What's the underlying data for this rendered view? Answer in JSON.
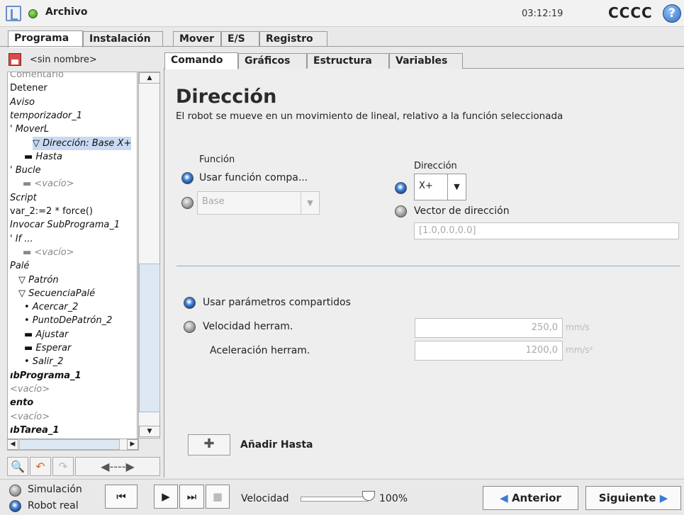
{
  "header": {
    "file_menu": "Archivo",
    "clock": "03:12:19",
    "robot_name": "CCCC",
    "help": "?"
  },
  "main_tabs": [
    "Programa",
    "Instalación",
    "Mover",
    "E/S",
    "Registro"
  ],
  "left": {
    "program_name": "<sin nombre>",
    "tree": [
      {
        "text": "Comentario",
        "cls": "g"
      },
      {
        "text": "Detener",
        "cls": ""
      },
      {
        "text": "Aviso",
        "cls": "i"
      },
      {
        "text": "temporizador_1",
        "cls": "i"
      },
      {
        "text": "' MoverL",
        "cls": "i"
      },
      {
        "text": "▽ Dirección: Base X+",
        "cls": "i sel"
      },
      {
        "text": "▬ Hasta",
        "cls": "i"
      },
      {
        "text": "' Bucle",
        "cls": "i"
      },
      {
        "text": "▬ <vacío>",
        "cls": "i g"
      },
      {
        "text": "Script",
        "cls": "i"
      },
      {
        "text": "var_2:=2 * force()",
        "cls": ""
      },
      {
        "text": "Invocar SubPrograma_1",
        "cls": "i"
      },
      {
        "text": "' If ...",
        "cls": "i"
      },
      {
        "text": "▬ <vacío>",
        "cls": "i g"
      },
      {
        "text": "Palé",
        "cls": "i"
      },
      {
        "text": "▽ Patrón",
        "cls": "i"
      },
      {
        "text": "▽ SecuenciaPalé",
        "cls": "i"
      },
      {
        "text": "• Acercar_2",
        "cls": "i"
      },
      {
        "text": "• PuntoDePatrón_2",
        "cls": "i"
      },
      {
        "text": "▬ Ajustar",
        "cls": "i"
      },
      {
        "text": "▬ Esperar",
        "cls": "i"
      },
      {
        "text": "• Salir_2",
        "cls": "i"
      },
      {
        "text": "ıbPrograma_1",
        "cls": "b"
      },
      {
        "text": "<vacío>",
        "cls": "i g"
      },
      {
        "text": "ento",
        "cls": "b"
      },
      {
        "text": "<vacío>",
        "cls": "i g"
      },
      {
        "text": "ıbTarea_1",
        "cls": "b"
      }
    ]
  },
  "sub_tabs": [
    "Comando",
    "Gráficos",
    "Estructura",
    "Variables"
  ],
  "command": {
    "title": "Dirección",
    "subtitle": "El robot se mueve en un movimiento de lineal, relativo a la función seleccionada",
    "function_label": "Función",
    "use_shared_feature": "Usar función compa...",
    "feature_value": "Base",
    "direction_label": "Dirección",
    "direction_value": "X+",
    "direction_vector_label": "Vector de dirección",
    "direction_vector_value": "[1.0,0.0,0.0]",
    "use_shared_params": "Usar parámetros compartidos",
    "tool_speed_label": "Velocidad herram.",
    "tool_speed_value": "250,0",
    "tool_speed_unit": "mm/s",
    "tool_accel_label": "Aceleración herram.",
    "tool_accel_value": "1200,0",
    "tool_accel_unit": "mm/s²",
    "add_until_label": "Añadir Hasta"
  },
  "footer": {
    "simulation": "Simulación",
    "real_robot": "Robot real",
    "speed_label": "Velocidad",
    "speed_value": "100%",
    "speed_fraction": 1.0,
    "prev": "Anterior",
    "next": "Siguiente"
  }
}
